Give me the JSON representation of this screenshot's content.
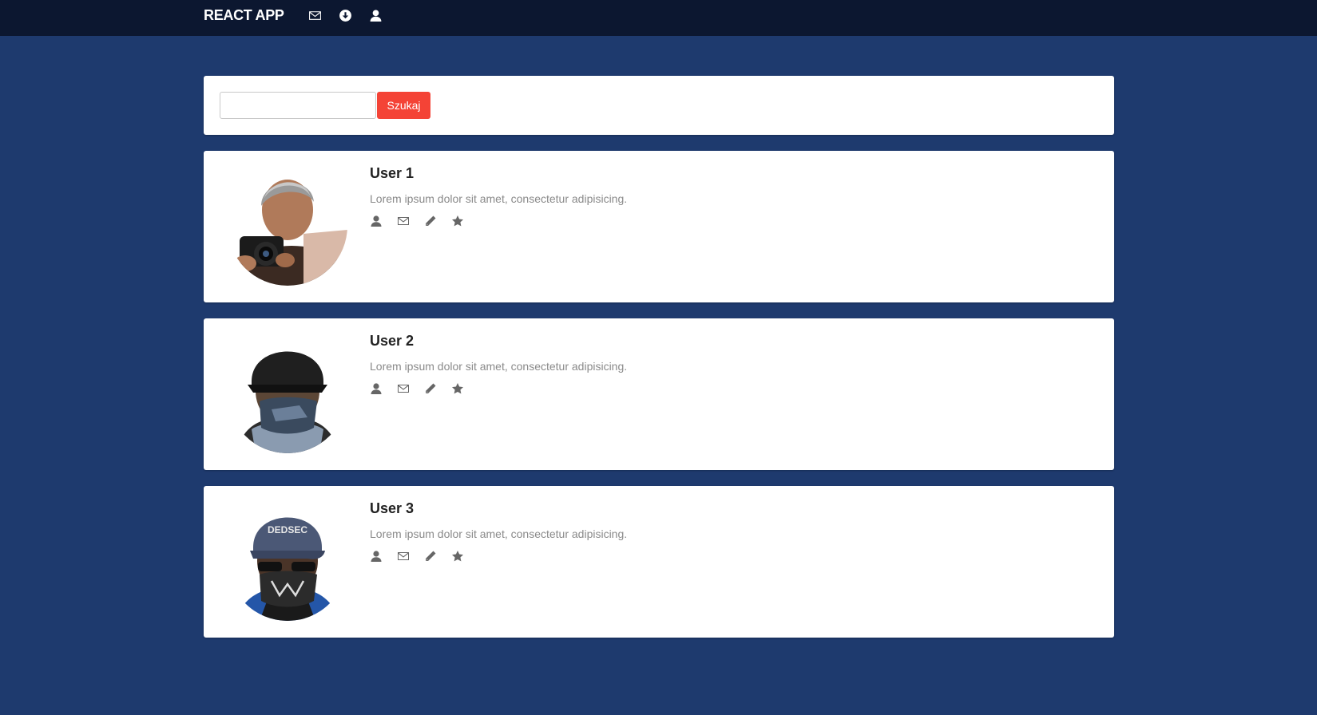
{
  "navbar": {
    "brand": "REACT APP",
    "icons": [
      "envelope-icon",
      "download-icon",
      "user-icon"
    ]
  },
  "search": {
    "value": "",
    "placeholder": "",
    "button_label": "Szukaj"
  },
  "users": [
    {
      "name": "User 1",
      "description": "Lorem ipsum dolor sit amet, consectetur adipisicing.",
      "avatar": "photographer-with-camera"
    },
    {
      "name": "User 2",
      "description": "Lorem ipsum dolor sit amet, consectetur adipisicing.",
      "avatar": "masked-man-dark-cap"
    },
    {
      "name": "User 3",
      "description": "Lorem ipsum dolor sit amet, consectetur adipisicing.",
      "avatar": "masked-man-blue-cap"
    }
  ],
  "actions": [
    "user-icon",
    "envelope-icon",
    "pencil-icon",
    "star-icon"
  ],
  "colors": {
    "background": "#1e3a6e",
    "navbar": "#0c1730",
    "button": "#f44336",
    "card": "#ffffff"
  }
}
